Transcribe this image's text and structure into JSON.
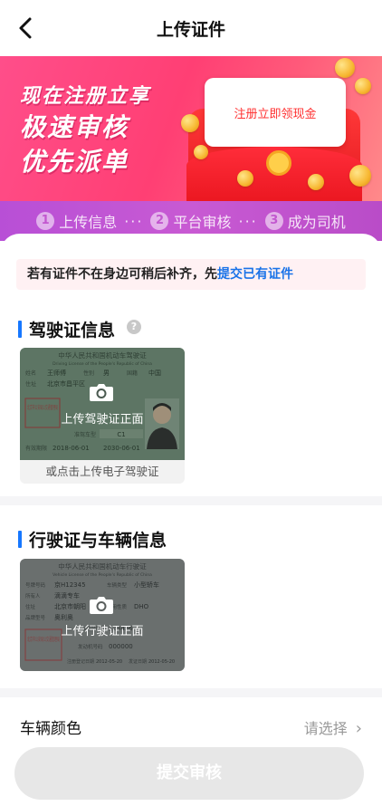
{
  "nav": {
    "title": "上传证件"
  },
  "banner": {
    "slogan_line1": "现在注册立享",
    "slogan_line2": "极速审核",
    "slogan_line3": "优先派单",
    "envelope_text": "注册立即领现金"
  },
  "steps": [
    {
      "num": "1",
      "label": "上传信息"
    },
    {
      "num": "2",
      "label": "平台审核"
    },
    {
      "num": "3",
      "label": "成为司机"
    }
  ],
  "steps_separator": "···",
  "notice": {
    "text": "若有证件不在身边可稍后补齐，先",
    "link": "提交已有证件"
  },
  "driver_section": {
    "title": "驾驶证信息",
    "help_icon": "?",
    "upload_text": "上传驾驶证正面",
    "alt_upload": "或点击上传电子驾驶证",
    "sample": {
      "header_cn": "中华人民共和国机动车驾驶证",
      "header_en": "Driving License of the People's Republic of China",
      "name_label": "姓名",
      "name": "王师傅",
      "sex_label": "性别",
      "sex": "男",
      "nationality_label": "国籍",
      "nationality": "中国",
      "address_label": "住址",
      "address": "北京市昌平区",
      "seal": "北京市公安局公交通管理局",
      "class_label": "准驾车型",
      "class": "C1",
      "valid_label": "有效期限",
      "valid_from": "2018-06-01",
      "valid_to": "2030-06-01"
    }
  },
  "vehicle_section": {
    "title": "行驶证与车辆信息",
    "upload_text": "上传行驶证正面",
    "sample": {
      "header_cn": "中华人民共和国机动车行驶证",
      "header_en": "Vehicle License of the People's Republic of China",
      "plate_label": "号牌号码",
      "plate": "京H12345",
      "type_label": "车辆类型",
      "type": "小型轿车",
      "owner_label": "所有人",
      "owner": "滴滴专车",
      "address_label": "住址",
      "address": "北京市朝阳",
      "use_label": "使用性质",
      "use": "DHO",
      "model_label": "品牌型号",
      "model": "奥利奥",
      "vin_label": "识别代号",
      "vin": "123456",
      "engine_label": "发动机号码",
      "engine": "000000",
      "seal": "北京市公安局公交通管理局",
      "reg_label": "注册登记日期",
      "reg_date": "2012-05-20",
      "issue_label": "发证日期",
      "issue_date": "2012-05-20"
    }
  },
  "vehicle_color": {
    "label": "车辆颜色",
    "value": "请选择",
    "chevron": "›"
  },
  "submit": {
    "label": "提交审核"
  }
}
